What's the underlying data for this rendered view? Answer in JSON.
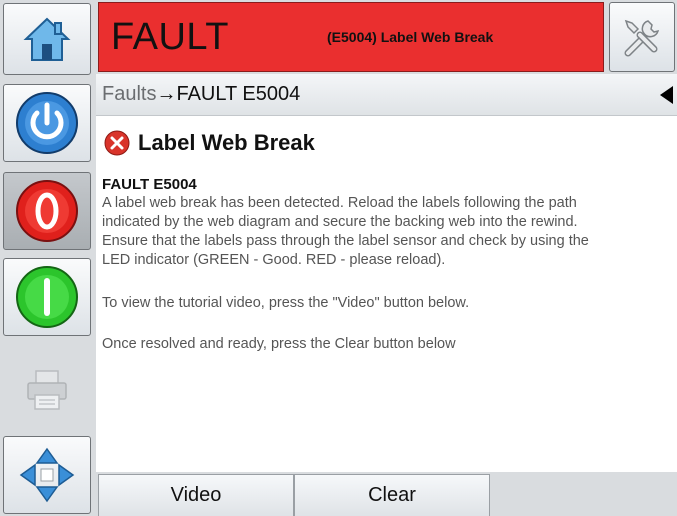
{
  "header": {
    "status": "FAULT",
    "message": "(E5004) Label Web Break",
    "status_color": "#ea2f2f"
  },
  "breadcrumb": {
    "parent": "Faults",
    "separator": "→",
    "current": "FAULT E5004"
  },
  "fault": {
    "title": "Label Web Break",
    "code": "FAULT E5004",
    "description_lines": [
      "A label web break has been detected. Reload the labels following the path",
      "indicated by the web diagram and secure the backing web into the rewind.",
      "Ensure that the labels pass through the label sensor and check by using the",
      "LED indicator (GREEN - Good. RED - please reload)."
    ],
    "video_hint": "To view the tutorial video, press the \"Video\" button below.",
    "clear_hint": "Once resolved and ready, press the Clear button below"
  },
  "buttons": {
    "video": "Video",
    "clear": "Clear"
  },
  "sidebar_icons": [
    "home-icon",
    "power-icon",
    "stop-icon",
    "start-icon",
    "printer-icon",
    "navigation-arrows-icon"
  ]
}
